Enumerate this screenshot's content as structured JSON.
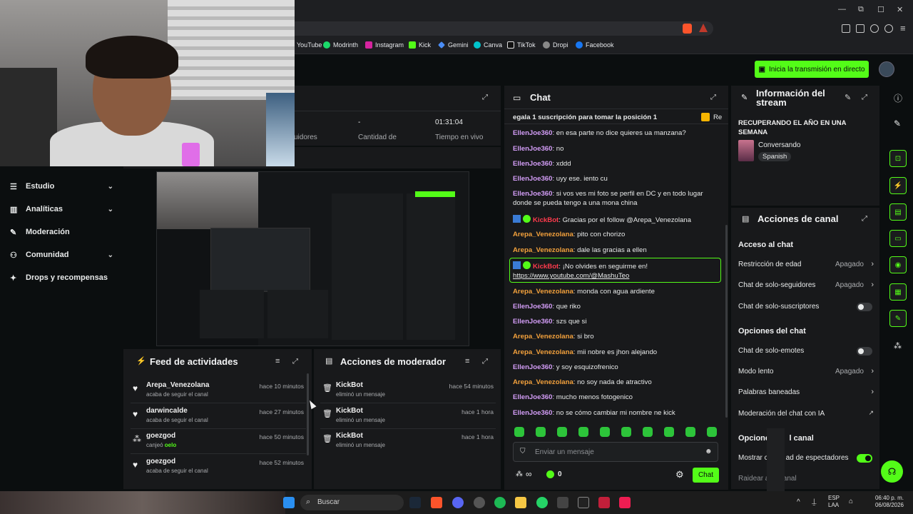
{
  "browser": {
    "address": "m",
    "bookmarks": [
      "YouTube",
      "Modrinth",
      "Instagram",
      "Kick",
      "Gemini",
      "Canva",
      "TikTok",
      "Dropi",
      "Facebook"
    ]
  },
  "header": {
    "go_live_label": "Inicia la transmisión en directo"
  },
  "nav": [
    {
      "label": "Estudio",
      "icon": "sliders-icon",
      "chevron": "⌄"
    },
    {
      "label": "Analíticas",
      "icon": "chart-icon",
      "chevron": "⌄"
    },
    {
      "label": "Moderación",
      "icon": "wrench-icon",
      "chevron": ""
    },
    {
      "label": "Comunidad",
      "icon": "community-icon",
      "chevron": "⌄"
    },
    {
      "label": "Drops y recompensas",
      "icon": "gift-icon",
      "chevron": ""
    }
  ],
  "stats": {
    "followers_label": "uidores",
    "subs_value": "-",
    "subs_label": "Cantidad de",
    "live_time_value": "01:31:04",
    "live_time_label": "Tiempo en vivo"
  },
  "feed": {
    "title": "Feed de actividades",
    "items": [
      {
        "name": "Arepa_Venezolana",
        "sub": "acaba de seguir el canal",
        "time": "hace 10 minutos",
        "icon": "heart-icon"
      },
      {
        "name": "darwincalde",
        "sub": "acaba de seguir el canal",
        "time": "hace 27 minutos",
        "icon": "heart-icon"
      },
      {
        "name": "goezgod",
        "sub_prefix": "canjeó ",
        "sub_highlight": "oelo",
        "time": "hace 50 minutos",
        "icon": "points-icon"
      },
      {
        "name": "goezgod",
        "sub": "acaba de seguir el canal",
        "time": "hace 52 minutos",
        "icon": "heart-icon"
      }
    ]
  },
  "mod_actions": {
    "title": "Acciones de moderador",
    "items": [
      {
        "name": "KickBot",
        "sub": "eliminó un mensaje",
        "time": "hace 54 minutos"
      },
      {
        "name": "KickBot",
        "sub": "eliminó un mensaje",
        "time": "hace 1 hora"
      },
      {
        "name": "KickBot",
        "sub": "eliminó un mensaje",
        "time": "hace 1 hora"
      }
    ]
  },
  "chat": {
    "title": "Chat",
    "pinned": "egala 1 suscripción para tomar la posición 1",
    "pinned_right": "Re",
    "messages": [
      {
        "user": "EllenJoe360",
        "color": "pink",
        "text": ": en esa parte no dice quieres ua manzana?"
      },
      {
        "user": "EllenJoe360",
        "color": "pink",
        "text": ": no"
      },
      {
        "user": "EllenJoe360",
        "color": "pink",
        "text": ": xddd"
      },
      {
        "user": "EllenJoe360",
        "color": "pink",
        "text": ": uyy ese. iento cu"
      },
      {
        "user": "EllenJoe360",
        "color": "pink",
        "text": ": si vos ves mi foto se perfil en DC y en todo lugar donde se pueda tengo a una mona china"
      },
      {
        "user": "KickBot",
        "color": "bot",
        "text": ": Gracias por el follow @Arepa_Venezolana"
      },
      {
        "user": "Arepa_Venezolana",
        "color": "orange",
        "text": ": pito con chorizo"
      },
      {
        "user": "Arepa_Venezolana",
        "color": "orange",
        "text": ": dale las gracias a ellen"
      },
      {
        "user": "KickBot",
        "color": "bot",
        "text": ": ¡No olvides en seguirme en!",
        "link": "https://www.youtube.com/@MashuTeo"
      },
      {
        "user": "Arepa_Venezolana",
        "color": "orange",
        "text": ": monda con agua ardiente"
      },
      {
        "user": "EllenJoe360",
        "color": "pink",
        "text": ": que riko"
      },
      {
        "user": "EllenJoe360",
        "color": "pink",
        "text": ": szs que si"
      },
      {
        "user": "Arepa_Venezolana",
        "color": "orange",
        "text": ": si bro"
      },
      {
        "user": "Arepa_Venezolana",
        "color": "orange",
        "text": ": mii nobre es jhon alejando"
      },
      {
        "user": "EllenJoe360",
        "color": "pink",
        "text": ": y soy esquizofrenico"
      },
      {
        "user": "Arepa_Venezolana",
        "color": "orange",
        "text": ": no soy nada de atractivo"
      },
      {
        "user": "EllenJoe360",
        "color": "pink",
        "text": ": mucho menos fotogenico"
      },
      {
        "user": "EllenJoe360",
        "color": "pink",
        "text": ": no se cómo cambiar mi nombre ne kick"
      }
    ],
    "input_placeholder": "Enviar un mensaje",
    "points": "0",
    "infinity": "∞",
    "send_label": "Chat"
  },
  "stream_info": {
    "title": "Información del stream",
    "stream_title": "RECUPERANDO EL AÑO EN UNA SEMANA",
    "category": "Conversando",
    "language": "Spanish"
  },
  "channel_actions": {
    "title": "Acciones de canal",
    "chat_access_title": "Acceso al chat",
    "age_restriction": "Restricción de edad",
    "age_restriction_value": "Apagado",
    "followers_only": "Chat de solo-seguidores",
    "followers_only_value": "Apagado",
    "subs_only": "Chat de solo-suscriptores",
    "chat_options_title": "Opciones del chat",
    "emotes_only": "Chat de solo-emotes",
    "slow_mode": "Modo lento",
    "slow_mode_value": "Apagado",
    "banned_words": "Palabras baneadas",
    "ai_moderation": "Moderación del chat con IA",
    "channel_options_title": "Opcione         l canal",
    "show_viewers": "Mostrar c         ad de espectadores",
    "raid": "Raidear a       anal"
  },
  "taskbar": {
    "search_label": "Buscar",
    "lang": "ESP",
    "layout": "LAA",
    "time": "06:40 p. m.",
    "date": "06/08/2026"
  },
  "colors": {
    "accent": "#53fc18",
    "pink_user": "#d39df7",
    "orange_user": "#f3a13c",
    "bot_user": "#ff3b4d"
  }
}
